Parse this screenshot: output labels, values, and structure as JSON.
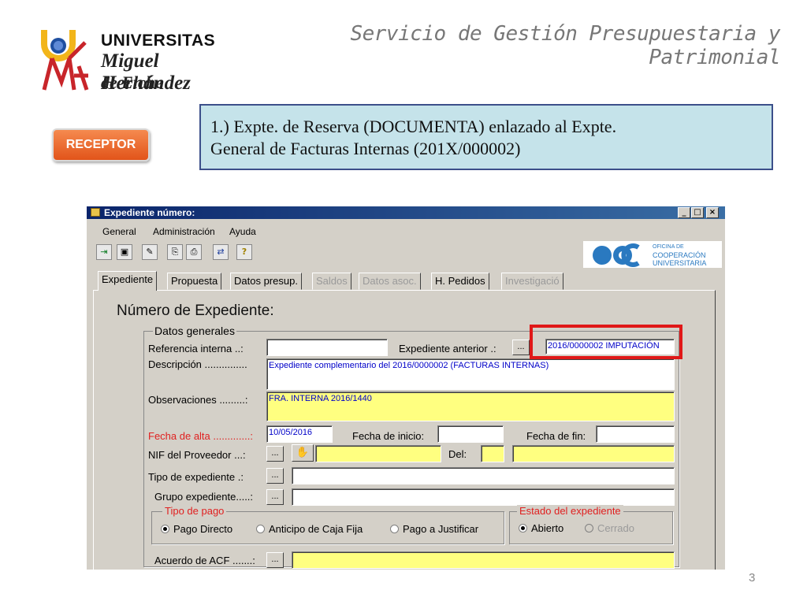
{
  "header": {
    "logo": {
      "line1": "UNIVERSITAS",
      "line2": "Miguel Hernández",
      "line3": "de Elche"
    },
    "service_title": "Servicio de Gestión Presupuestaria y Patrimonial"
  },
  "receptor_label": "RECEPTOR",
  "callout": {
    "line1": "1.) Expte. de Reserva (DOCUMENTA) enlazado al Expte.",
    "line2": "General de Facturas Internas (201X/000002)"
  },
  "page_number": "3",
  "window": {
    "title": "Expediente número:",
    "menu": [
      "General",
      "Administración",
      "Ayuda"
    ],
    "oficina": {
      "line1": "OFICINA DE",
      "line2": "COOPERACIÓN",
      "line3": "UNIVERSITARIA"
    },
    "tabs": [
      {
        "label": "Expediente",
        "state": "active"
      },
      {
        "label": "Propuesta",
        "state": "enabled"
      },
      {
        "label": "Datos presup.",
        "state": "enabled"
      },
      {
        "label": "Saldos",
        "state": "disabled"
      },
      {
        "label": "Datos asoc.",
        "state": "disabled"
      },
      {
        "label": "H. Pedidos",
        "state": "enabled"
      },
      {
        "label": "Investigació",
        "state": "disabled"
      }
    ],
    "heading": "Número de Expediente:",
    "group_label": "Datos generales",
    "fields": {
      "referencia_interna": {
        "label": "Referencia interna ..:",
        "value": ""
      },
      "expediente_anterior": {
        "label": "Expediente anterior .:",
        "value": "2016/0000002 IMPUTACIÓN"
      },
      "descripcion": {
        "label": "Descripción ...............",
        "value": "Expediente complementario del 2016/0000002 (FACTURAS INTERNAS)"
      },
      "observaciones": {
        "label": "Observaciones .........:",
        "value": "FRA. INTERNA 2016/1440"
      },
      "fecha_alta": {
        "label": "Fecha de alta .............:",
        "value": "10/05/2016"
      },
      "fecha_inicio": {
        "label": "Fecha de inicio:",
        "value": ""
      },
      "fecha_fin": {
        "label": "Fecha de fin:",
        "value": ""
      },
      "nif_proveedor": {
        "label": "NIF del Proveedor ...:",
        "value": ""
      },
      "del": {
        "label": "Del:",
        "value": ""
      },
      "tipo_expediente": {
        "label": "Tipo de expediente .:",
        "value": ""
      },
      "grupo_expediente": {
        "label": "Grupo expediente.....:",
        "value": ""
      },
      "acuerdo_acf": {
        "label": "Acuerdo de ACF .......:",
        "value": ""
      }
    },
    "ellipsis_button": "...",
    "tipo_pago": {
      "label": "Tipo de pago",
      "options": [
        {
          "label": "Pago Directo",
          "selected": true
        },
        {
          "label": "Anticipo de Caja Fija",
          "selected": false
        },
        {
          "label": "Pago a Justificar",
          "selected": false
        }
      ]
    },
    "estado": {
      "label": "Estado del expediente",
      "options": [
        {
          "label": "Abierto",
          "selected": true,
          "enabled": true
        },
        {
          "label": "Cerrado",
          "selected": false,
          "enabled": false
        }
      ]
    }
  }
}
